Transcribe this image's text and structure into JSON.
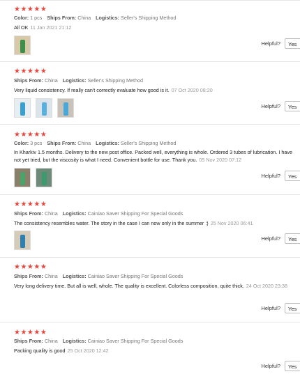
{
  "helpful_label": "Helpful?",
  "yes_label": "Yes",
  "reviews": [
    {
      "stars": "★★★★★",
      "color_label": "Color:",
      "color_value": "1 pcs",
      "ships_label": "Ships From:",
      "ships_value": "China",
      "logistics_label": "Logistics:",
      "logistics_value": "Seller's Shipping Method",
      "text": "All OK",
      "date": "11 Jan 2021 21:12"
    },
    {
      "stars": "★★★★★",
      "ships_label": "Ships From:",
      "ships_value": "China",
      "logistics_label": "Logistics:",
      "logistics_value": "Seller's Shipping Method",
      "text": "Very liquid consistency. If really can't correctly evaluate how good is it.",
      "date": "07 Oct 2020 08:20"
    },
    {
      "stars": "★★★★★",
      "color_label": "Color:",
      "color_value": "3 pcs",
      "ships_label": "Ships From:",
      "ships_value": "China",
      "logistics_label": "Logistics:",
      "logistics_value": "Seller's Shipping Method",
      "text": "In Kharkiv 1.5 months. Delivery to the new post office. Packed well, everything is whole. Ordered 3 tubes of lubrication. I have not yet tried, but the viscosity is what I need. Convenient bottle for use. Thank you.",
      "date": "05 Nov 2020 07:12"
    },
    {
      "stars": "★★★★★",
      "ships_label": "Ships From:",
      "ships_value": "China",
      "logistics_label": "Logistics:",
      "logistics_value": "Cainiao Saver Shipping For Special Goods",
      "text": "The consistency resembles water. The story in the case I can now only in the summer :)",
      "date": "25 Nov 2020 06:41"
    },
    {
      "stars": "★★★★★",
      "ships_label": "Ships From:",
      "ships_value": "China",
      "logistics_label": "Logistics:",
      "logistics_value": "Cainiao Saver Shipping For Special Goods",
      "text": "Very long delivery time. But all is well, whole. The quality is excellent. Colorless composition, quite thick.",
      "date": "24 Oct 2020 23:38"
    },
    {
      "stars": "★★★★★",
      "ships_label": "Ships From:",
      "ships_value": "China",
      "logistics_label": "Logistics:",
      "logistics_value": "Cainiao Saver Shipping For Special Goods",
      "text": "Packing quality is good",
      "date": "25 Oct 2020 12:42"
    }
  ]
}
